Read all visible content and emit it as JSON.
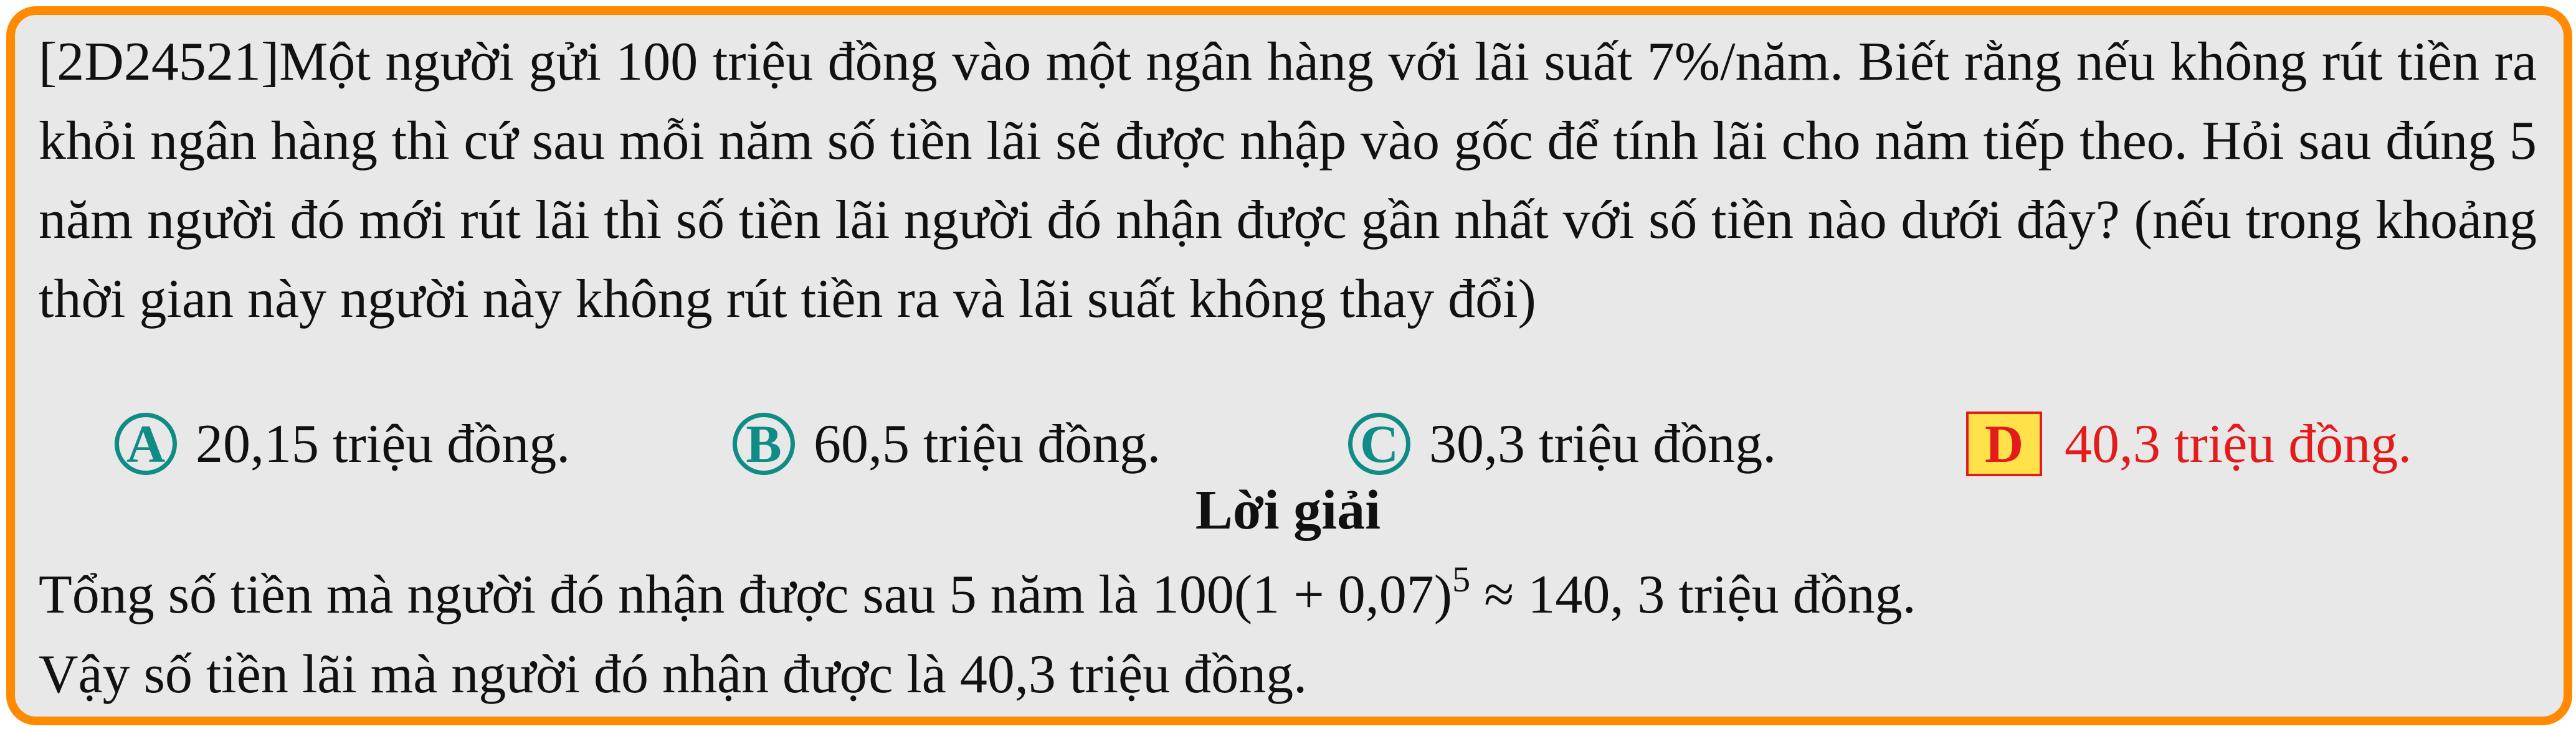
{
  "question": {
    "text": "[2D24521]Một người gửi 100 triệu đồng vào một ngân hàng với lãi suất 7%/năm. Biết rằng nếu không rút tiền ra khỏi ngân hàng thì cứ sau mỗi năm số tiền lãi sẽ được nhập vào gốc để tính lãi cho năm tiếp theo. Hỏi sau đúng 5 năm người đó mới rút lãi thì số tiền lãi người đó nhận được gần nhất với số tiền nào dưới đây? (nếu trong khoảng thời gian này người này không rút tiền ra và lãi suất không thay đổi)"
  },
  "choices": [
    {
      "letter": "A",
      "text": "20,15 triệu đồng."
    },
    {
      "letter": "B",
      "text": "60,5 triệu đồng."
    },
    {
      "letter": "C",
      "text": "30,3 triệu đồng."
    },
    {
      "letter": "D",
      "text": "40,3 triệu đồng.",
      "correct": true
    }
  ],
  "solution": {
    "title": "Lời giải",
    "line1_before": "Tổng số tiền mà người đó nhận được sau 5 năm là 100(1 + 0,07)",
    "line1_exp": "5",
    "line1_after": " ≈ 140, 3 triệu đồng.",
    "line2": "Vậy số tiền lãi mà người đó nhận được là 40,3 triệu đồng."
  },
  "colors": {
    "border": "#ff8a00",
    "background": "#e8e8e8",
    "choice_badge": "#0f8c86",
    "correct_text": "#e31b1b",
    "correct_badge_fill": "#ffe14a"
  }
}
